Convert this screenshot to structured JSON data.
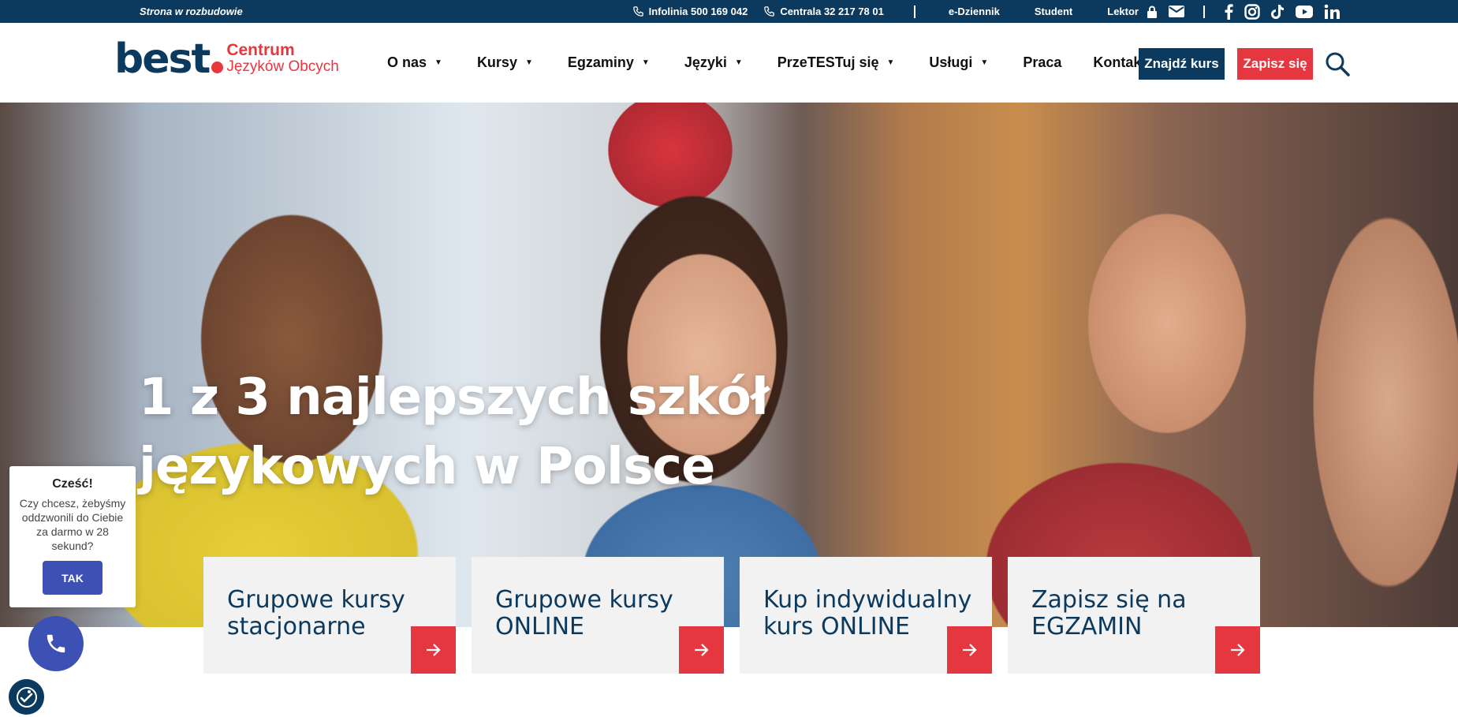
{
  "topbar": {
    "notice": "Strona w rozbudowie",
    "hotline": "Infolinia 500 169 042",
    "central": "Centrala 32 217 78 01",
    "links": [
      "e-Dziennik",
      "Student",
      "Lektor"
    ],
    "icons": [
      "lock-icon",
      "mail-icon",
      "facebook-icon",
      "instagram-icon",
      "tiktok-icon",
      "youtube-icon",
      "linkedin-icon"
    ]
  },
  "logo": {
    "word": "best",
    "line1": "Centrum",
    "line2": "Języków Obcych"
  },
  "nav": {
    "items": [
      {
        "label": "O nas",
        "dropdown": true
      },
      {
        "label": "Kursy",
        "dropdown": true
      },
      {
        "label": "Egzaminy",
        "dropdown": true
      },
      {
        "label": "Języki",
        "dropdown": true
      },
      {
        "label": "PrzeTESTuj się",
        "dropdown": true
      },
      {
        "label": "Usługi",
        "dropdown": true
      },
      {
        "label": "Praca",
        "dropdown": false
      },
      {
        "label": "Kontakt",
        "dropdown": false
      }
    ],
    "caret": "▼",
    "find_course": "Znajdź kurs",
    "sign_up": "Zapisz się"
  },
  "hero": {
    "title_line1": "1 z 3 najlepszych szkół",
    "title_line2": "językowych w Polsce"
  },
  "cards": [
    {
      "line1": "Grupowe kursy",
      "line2": "stacjonarne"
    },
    {
      "line1": "Grupowe kursy",
      "line2": "ONLINE"
    },
    {
      "line1": "Kup indywidualny",
      "line2": "kurs ONLINE"
    },
    {
      "line1": "Zapisz się na",
      "line2": "EGZAMIN"
    }
  ],
  "callback": {
    "greeting": "Cześć!",
    "message": "Czy chcesz, żebyśmy oddzwonili do Ciebie za darmo w 28 sekund?",
    "yes_label": "TAK"
  },
  "colors": {
    "navy": "#0b3a5e",
    "red": "#e5373f",
    "widget_blue": "#3d51b5"
  }
}
